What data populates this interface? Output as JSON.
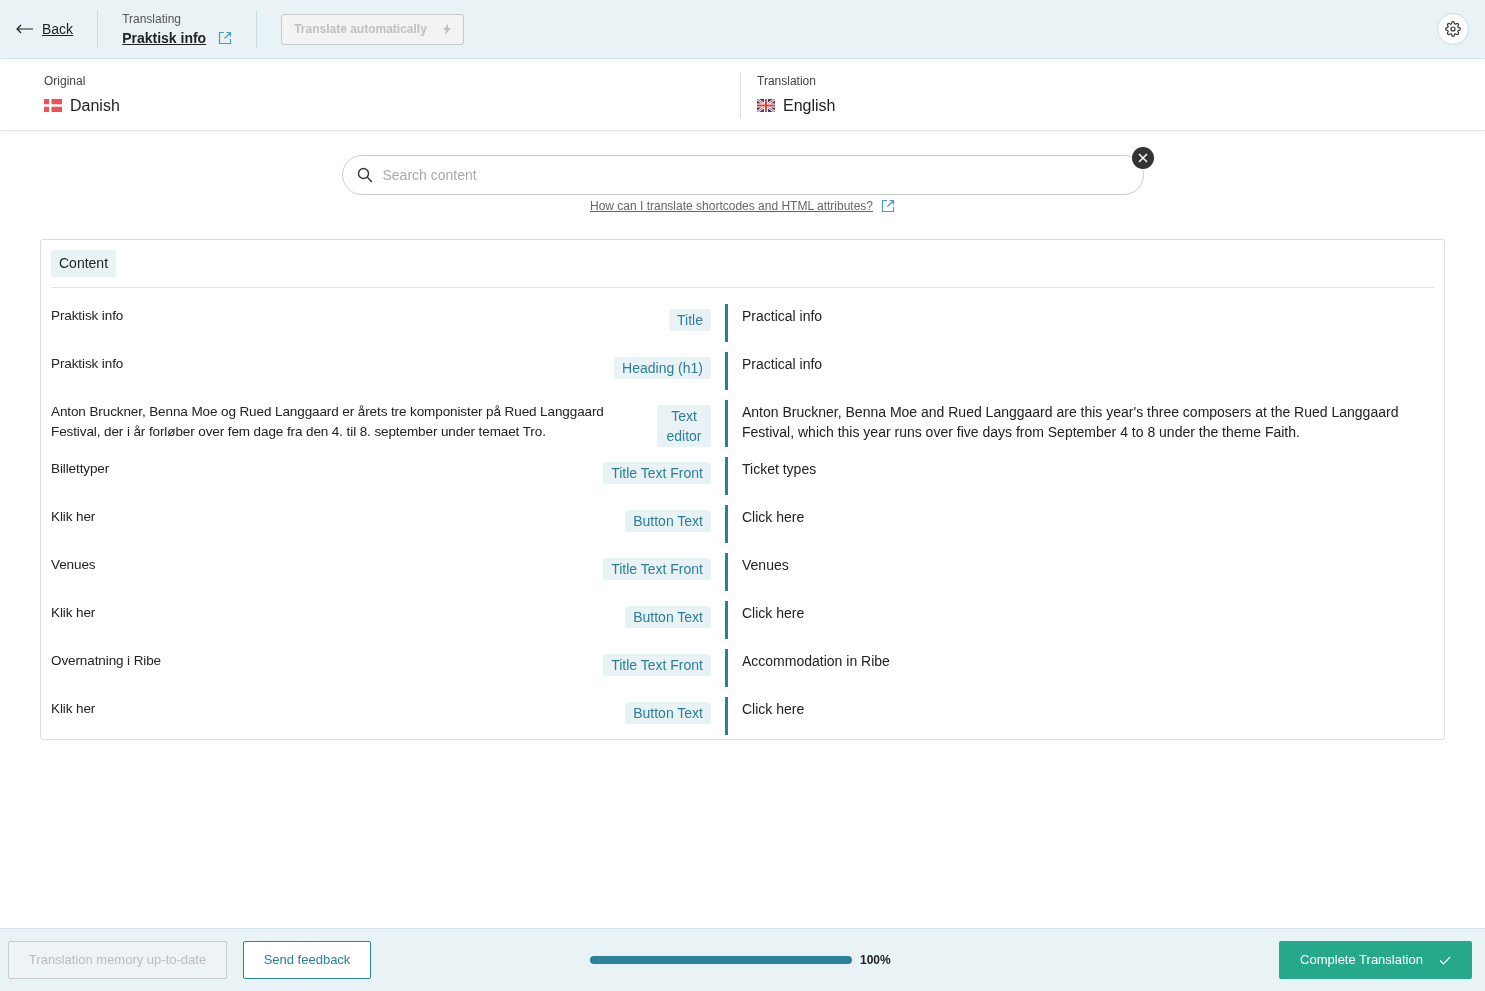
{
  "header": {
    "back": "Back",
    "translating_label": "Translating",
    "page_title": "Praktisk info",
    "auto_translate": {
      "label": "Translate automatically",
      "disabled": true
    }
  },
  "languages": {
    "original": {
      "label": "Original",
      "name": "Danish"
    },
    "translation": {
      "label": "Translation",
      "name": "English"
    }
  },
  "search": {
    "placeholder": "Search content",
    "help_link": "How can I translate shortcodes and HTML attributes?"
  },
  "section": {
    "title": "Content"
  },
  "rows": [
    {
      "source": "Praktisk info",
      "tag": "Title",
      "translation": "Practical info"
    },
    {
      "source": "Praktisk info",
      "tag": "Heading (h1)",
      "translation": "Practical info"
    },
    {
      "source": "Anton Bruckner, Benna Moe og Rued Langgaard er årets tre komponister på Rued Langgaard Festival, der i år forløber over fem dage fra den 4. til 8. september under temaet Tro.",
      "tag": "Text editor",
      "translation": "Anton Bruckner, Benna Moe and Rued Langgaard are this year's three composers at the Rued Langgaard Festival, which this year runs over five days from September 4 to 8 under the theme Faith."
    },
    {
      "source": "Billettyper",
      "tag": "Title Text Front",
      "translation": "Ticket types"
    },
    {
      "source": "Klik her",
      "tag": "Button Text",
      "translation": "Click here"
    },
    {
      "source": "Venues",
      "tag": "Title Text Front",
      "translation": "Venues"
    },
    {
      "source": "Klik her",
      "tag": "Button Text",
      "translation": "Click here"
    },
    {
      "source": "Overnatning i Ribe",
      "tag": "Title Text Front",
      "translation": "Accommodation in Ribe"
    },
    {
      "source": "Klik her",
      "tag": "Button Text",
      "translation": "Click here"
    }
  ],
  "footer": {
    "memory": {
      "label": "Translation memory up-to-date",
      "disabled": true
    },
    "feedback": "Send feedback",
    "progress": {
      "level": 1,
      "reading": "100%"
    },
    "complete": "Complete Translation"
  }
}
